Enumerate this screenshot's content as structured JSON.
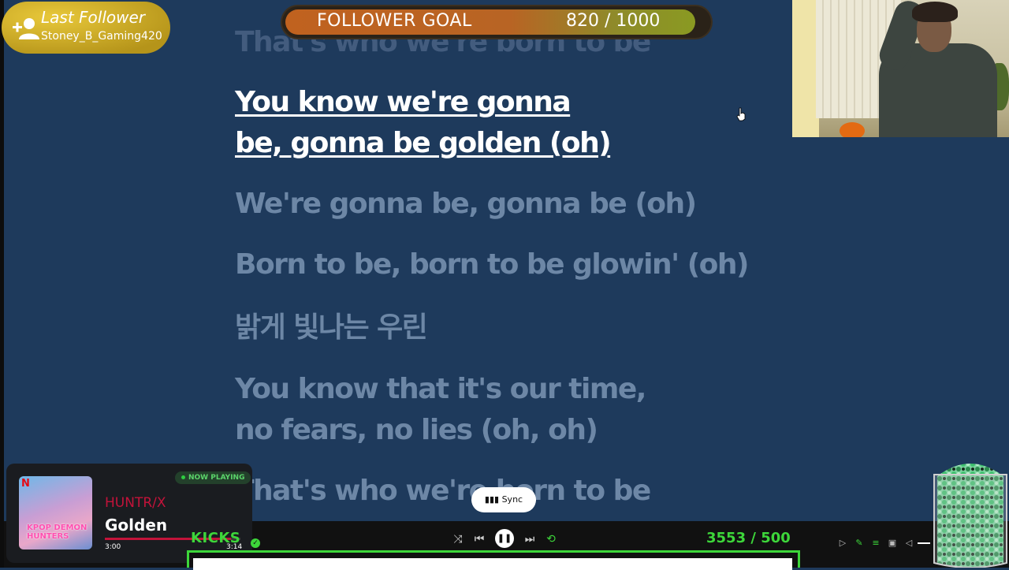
{
  "lyrics": {
    "prev_line": "That's who we're born to be",
    "active_line_1": "You know we're gonna",
    "active_line_2": "be, gonna be golden (oh)",
    "line_3": "We're gonna be, gonna be (oh)",
    "line_4": "Born to be, born to be glowin' (oh)",
    "line_5": "밝게 빛나는 우린",
    "line_6a": "You know that it's our time,",
    "line_6b": "no fears, no lies (oh, oh)",
    "line_7": "That's who we're born to be"
  },
  "follower_goal": {
    "label": "FOLLOWER GOAL",
    "count_text": "820  /  1000",
    "progress": 0.82
  },
  "last_follower": {
    "title": "Last Follower",
    "name": "Stoney_B_Gaming420"
  },
  "now_playing": {
    "badge": "NOW PLAYING",
    "artist": "HUNTR/X",
    "song": "Golden",
    "time_current": "3:00",
    "time_duration": "3:14",
    "progress": 0.93,
    "album_logo": "N",
    "album_title": "KPOP DEMON HUNTERS"
  },
  "sync_button": {
    "label": "Sync"
  },
  "kicks": {
    "label": "KICKS",
    "count_text": "3553  / 500"
  },
  "player_controls": {
    "shuffle": "shuffle-icon",
    "previous": "previous-icon",
    "play_pause": "pause-icon",
    "next": "next-icon",
    "repeat": "repeat-icon"
  },
  "colors": {
    "background": "#1e3a5c",
    "lyric_dim": "#6d87a6",
    "lyric_active": "#ffffff",
    "accent_green": "#3dd63a",
    "spotify_red": "#c3133a"
  }
}
